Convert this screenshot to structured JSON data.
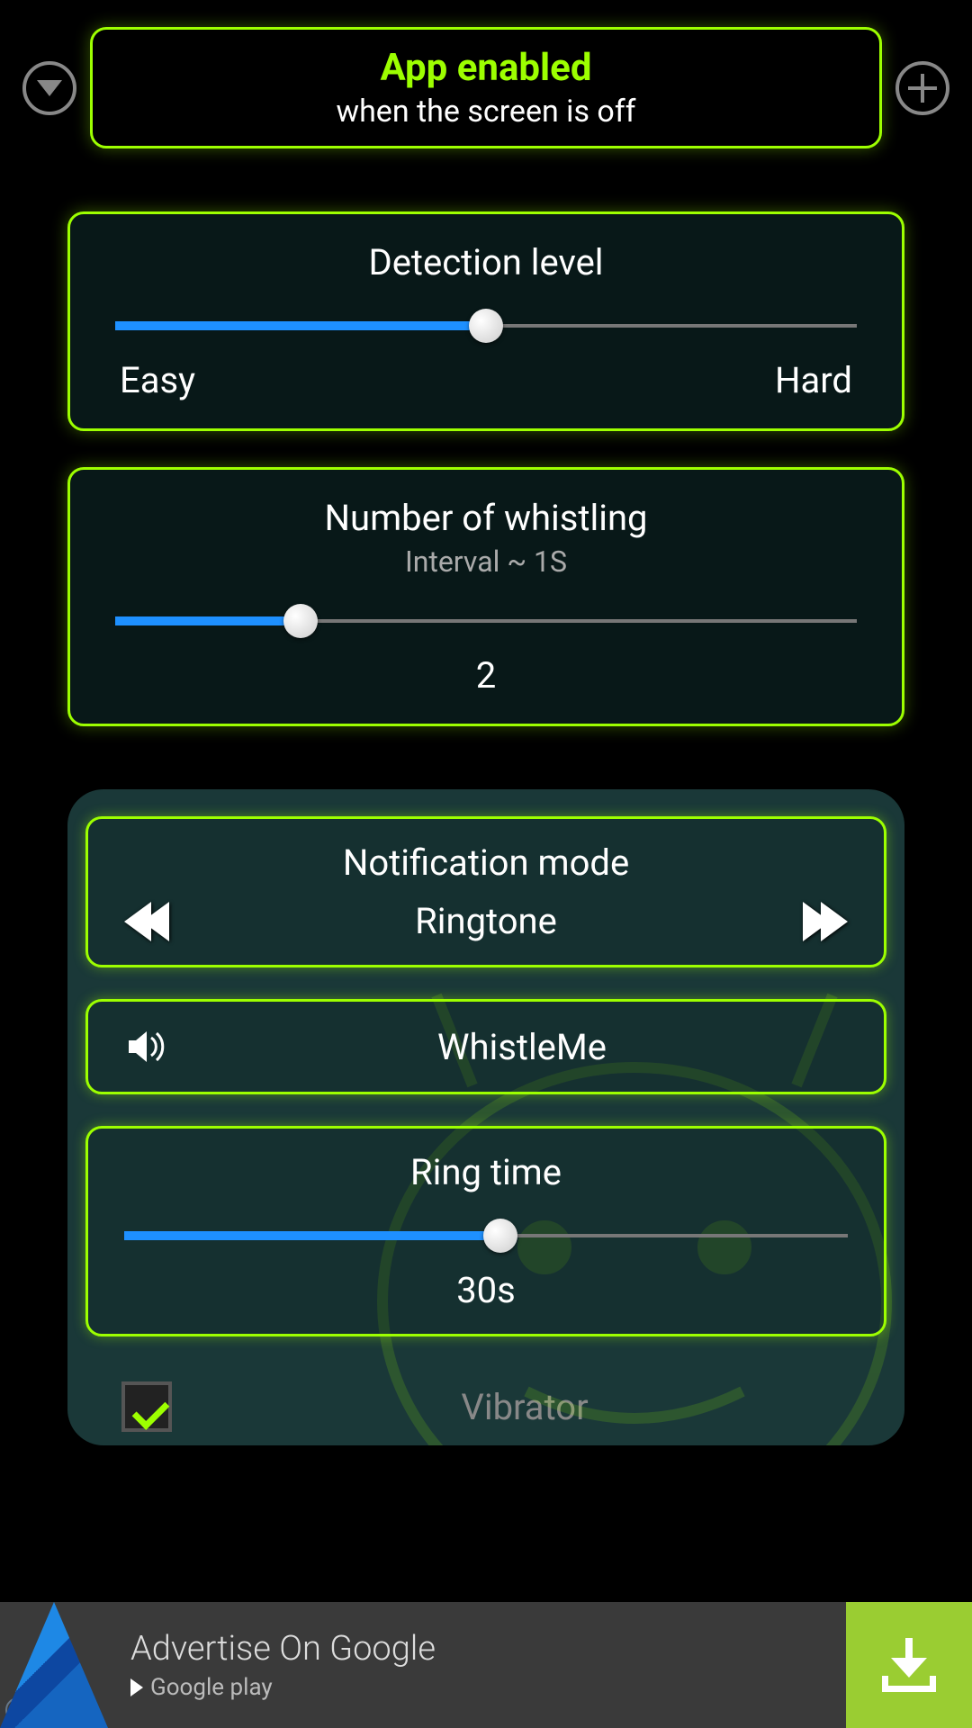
{
  "header": {
    "title": "App enabled",
    "subtitle": "when the screen is off"
  },
  "detection": {
    "title": "Detection level",
    "min_label": "Easy",
    "max_label": "Hard",
    "percent": 50
  },
  "whistling": {
    "title": "Number of whistling",
    "subtitle": "Interval ~ 1S",
    "value": "2",
    "percent": 25
  },
  "notification": {
    "title": "Notification mode",
    "mode": "Ringtone",
    "sound": "WhistleMe",
    "ringtime_title": "Ring time",
    "ringtime_value": "30s",
    "ringtime_percent": 52,
    "vibrator": "Vibrator"
  },
  "ad": {
    "title": "Advertise On Google",
    "store": "Google play"
  }
}
